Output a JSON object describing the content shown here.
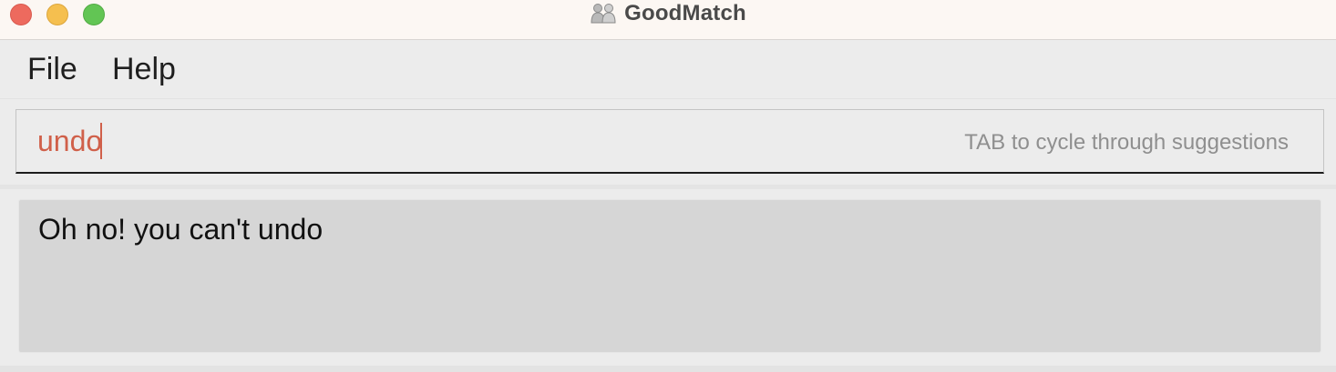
{
  "window": {
    "title": "GoodMatch",
    "icon": "two-people-icon",
    "controls": [
      "close",
      "minimize",
      "maximize"
    ],
    "colors": {
      "close": "#ed6a5e",
      "minimize": "#f5bf4f",
      "maximize": "#62c554"
    }
  },
  "menu": {
    "items": [
      {
        "label": "File"
      },
      {
        "label": "Help"
      }
    ]
  },
  "command": {
    "value": "undo",
    "hint": "TAB to cycle through suggestions",
    "text_color": "#d0604a"
  },
  "result": {
    "message": "Oh no! you can't undo"
  }
}
